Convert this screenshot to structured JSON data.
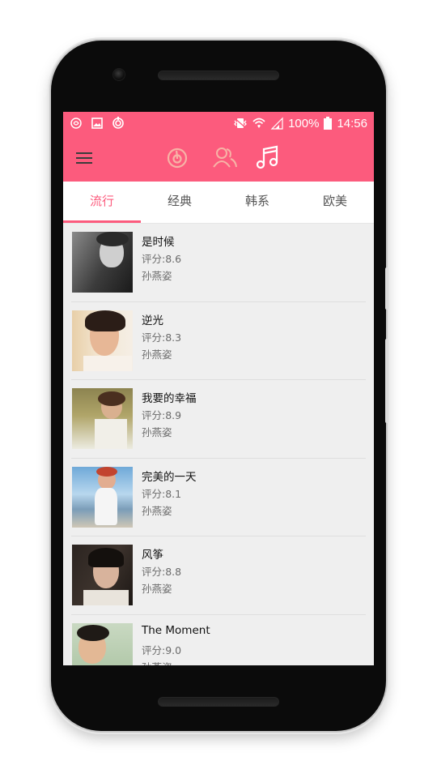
{
  "status_bar": {
    "battery": "100%",
    "time": "14:56"
  },
  "toolbar": {
    "icons": [
      "menu-icon",
      "netease-music-icon",
      "friends-icon",
      "music-note-icon"
    ],
    "colors": {
      "accent": "#fc5b7d",
      "inactive_icon": "#f7b3a6",
      "active_icon": "#ffffff"
    }
  },
  "tabs": [
    {
      "label": "流行",
      "active": true
    },
    {
      "label": "经典",
      "active": false
    },
    {
      "label": "韩系",
      "active": false
    },
    {
      "label": "欧美",
      "active": false
    }
  ],
  "songs": [
    {
      "title": "是时候",
      "score": "评分:8.6",
      "artist": "孙燕姿"
    },
    {
      "title": "逆光",
      "score": "评分:8.3",
      "artist": "孙燕姿"
    },
    {
      "title": "我要的幸福",
      "score": "评分:8.9",
      "artist": "孙燕姿"
    },
    {
      "title": "完美的一天",
      "score": "评分:8.1",
      "artist": "孙燕姿"
    },
    {
      "title": "风筝",
      "score": "评分:8.8",
      "artist": "孙燕姿"
    },
    {
      "title": "The Moment",
      "score": "评分:9.0",
      "artist": "孙燕姿"
    }
  ]
}
